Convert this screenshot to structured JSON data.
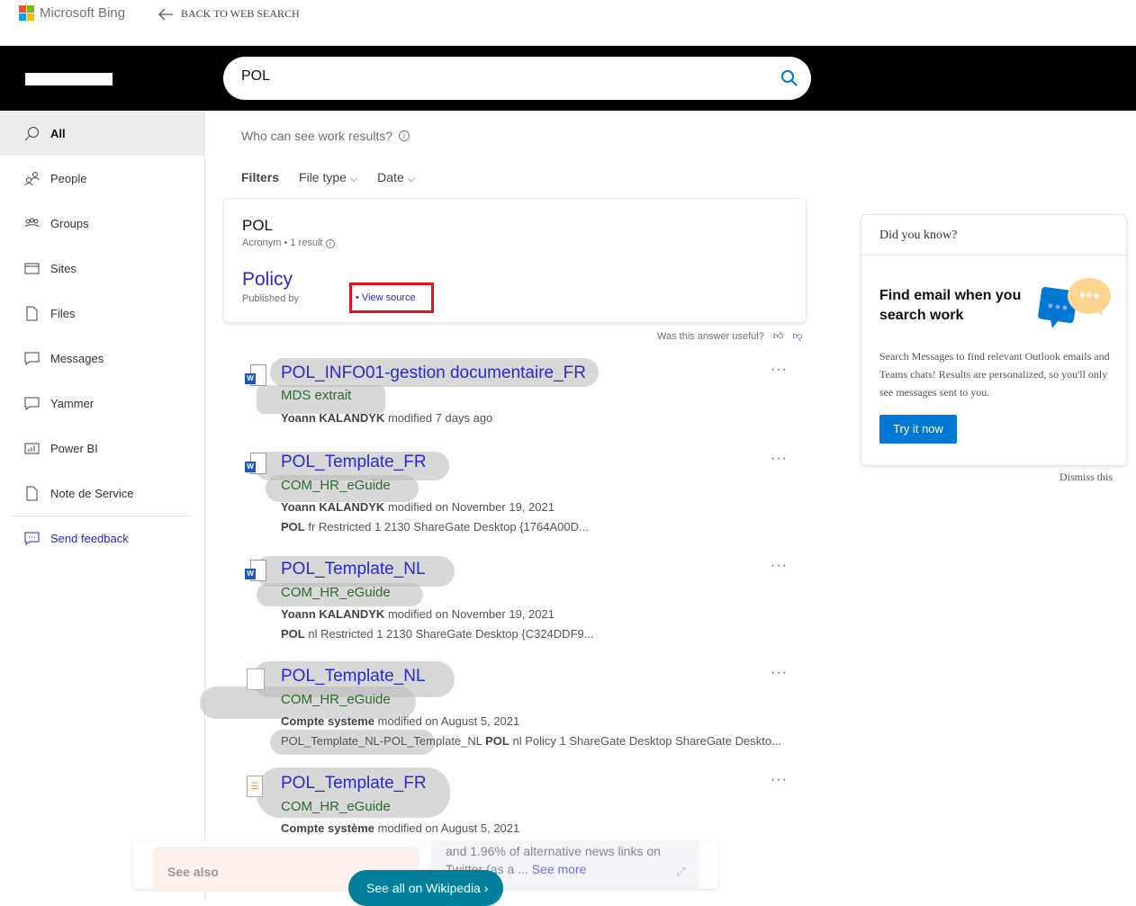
{
  "topbar": {
    "brand": "Microsoft Bing",
    "back_label": "BACK TO WEB SEARCH"
  },
  "search": {
    "query": "POL"
  },
  "sidebar": {
    "items": [
      {
        "label": "All",
        "icon": "search-icon"
      },
      {
        "label": "People",
        "icon": "people-icon"
      },
      {
        "label": "Groups",
        "icon": "groups-icon"
      },
      {
        "label": "Sites",
        "icon": "sites-icon"
      },
      {
        "label": "Files",
        "icon": "file-icon"
      },
      {
        "label": "Messages",
        "icon": "message-icon"
      },
      {
        "label": "Yammer",
        "icon": "message-icon"
      },
      {
        "label": "Power BI",
        "icon": "chart-icon"
      },
      {
        "label": "Note de Service",
        "icon": "file-icon"
      }
    ],
    "feedback": "Send feedback"
  },
  "main": {
    "who_can_see": "Who can see work results?",
    "filters": {
      "label": "Filters",
      "file_type": "File type",
      "date": "Date"
    },
    "acronym": {
      "term": "POL",
      "type": "Acronym",
      "count": "1 result",
      "meaning": "Policy",
      "published_by": "Published by",
      "view_source": "View source"
    },
    "useful": "Was this answer useful?",
    "results": [
      {
        "title": "POL_INFO01-gestion documentaire_FR",
        "subtitle": "MDS extrait",
        "author": "Yoann KALANDYK",
        "modified": "modified 7 days ago",
        "snippet_bold": "",
        "snippet": ""
      },
      {
        "title": "POL_Template_FR",
        "subtitle": "COM_HR_eGuide",
        "author": "Yoann KALANDYK",
        "modified": "modified on November 19, 2021",
        "snippet_bold": "POL",
        "snippet": " fr Restricted 1 2130 ShareGate Desktop {1764A00D..."
      },
      {
        "title": "POL_Template_NL",
        "subtitle": "COM_HR_eGuide",
        "author": "Yoann KALANDYK",
        "modified": "modified on November 19, 2021",
        "snippet_bold": "POL",
        "snippet": " nl Restricted 1 2130 ShareGate Desktop {C324DDF9..."
      },
      {
        "title": "POL_Template_NL",
        "subtitle": "COM_HR_eGuide",
        "author": "Compte systeme",
        "modified": "modified on August 5, 2021",
        "snippet_pre": "POL_Template_NL-POL_Template_NL ",
        "snippet_bold": "POL",
        "snippet": " nl Policy 1 ShareGate Desktop ShareGate Deskto..."
      },
      {
        "title": "POL_Template_FR",
        "subtitle": "COM_HR_eGuide",
        "author": "Compte système",
        "modified": "modified on August 5, 2021",
        "snippet_bold": "",
        "snippet": ""
      }
    ]
  },
  "did_you_know": {
    "header": "Did you know?",
    "title": "Find email when you search work",
    "body": "Search Messages to find relevant Outlook emails and Teams chats! Results are personalized, so you'll only see messages sent to you.",
    "button": "Try it now",
    "dismiss": "Dismiss this"
  },
  "wiki": {
    "see_also": "See also",
    "text": "and 1.96% of alternative news links on Twitter (as a ...",
    "see_more": "See more",
    "see_all": "See all on Wikipedia"
  },
  "colors": {
    "accent": "#0078d4",
    "link": "#2a2acc",
    "highlight": "#e81123",
    "wiki_button": "#00809d"
  }
}
